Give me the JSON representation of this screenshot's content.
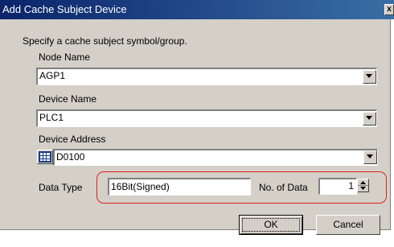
{
  "window": {
    "title": "Add Cache Subject Device",
    "close_glyph": "x"
  },
  "instruction": "Specify a cache subject symbol/group.",
  "node_name": {
    "label": "Node Name",
    "value": "AGP1"
  },
  "device_name": {
    "label": "Device Name",
    "value": "PLC1"
  },
  "device_address": {
    "label": "Device Address",
    "value": "D0100",
    "icon": "address-keypad-icon"
  },
  "data_type": {
    "label": "Data Type",
    "value": "16Bit(Signed)"
  },
  "no_of_data": {
    "label": "No. of Data",
    "value": "1"
  },
  "buttons": {
    "ok": "OK",
    "cancel": "Cancel"
  },
  "colors": {
    "highlight": "#e02020",
    "title_bar": "#0a246a"
  }
}
